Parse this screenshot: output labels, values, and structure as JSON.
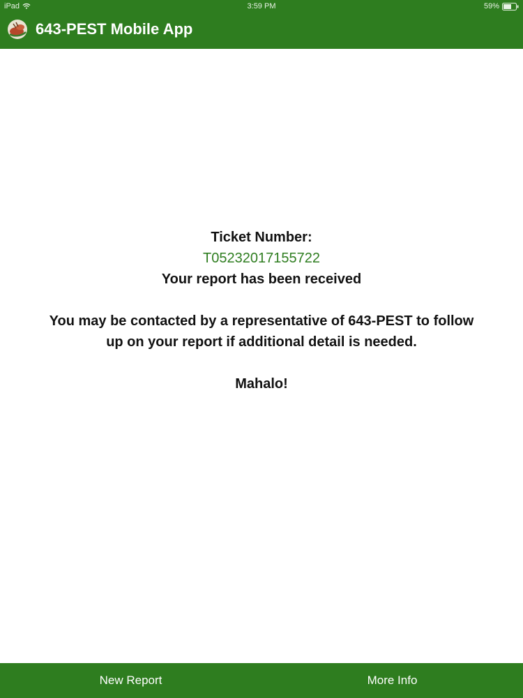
{
  "status_bar": {
    "carrier": "iPad",
    "time": "3:59 PM",
    "battery": "59%",
    "wifi_icon": "wifi-icon",
    "battery_icon": "battery-icon"
  },
  "app_bar": {
    "title": "643-PEST Mobile App",
    "logo_icon": "app-logo-icon"
  },
  "message": {
    "ticket_label": "Ticket Number:",
    "ticket_number": "T05232017155722",
    "received": "Your report has been received",
    "contact_line1": "You may be contacted by a representative of 643-PEST to follow",
    "contact_line2": "up on your report if additional detail is needed.",
    "closing": "Mahalo!"
  },
  "bottom_bar": {
    "new_report": "New Report",
    "more_info": "More Info"
  },
  "colors": {
    "brand_green": "#2e7d1f",
    "text": "#111111",
    "background": "#ffffff"
  }
}
